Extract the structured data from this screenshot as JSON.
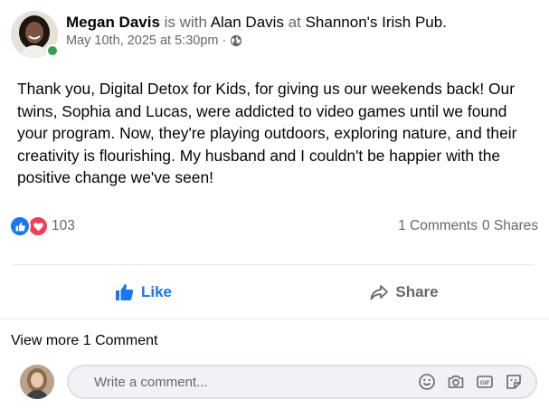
{
  "post": {
    "author": "Megan Davis",
    "with_text": " is with ",
    "tagged": "Alan Davis",
    "at_text": " at ",
    "place": "Shannon's Irish Pub.",
    "timestamp": "May 10th, 2025 at 5:30pm",
    "separator": "·",
    "privacy_icon": "globe-icon",
    "online": true,
    "body": "Thank you, Digital Detox for Kids, for giving us our weekends back! Our twins, Sophia and Lucas, were addicted to video games until we found your program. Now, they're playing outdoors, exploring nature, and their creativity is flourishing. My husband and I couldn't be happier with the positive change we've seen!"
  },
  "stats": {
    "reactions": [
      "like-icon",
      "love-icon"
    ],
    "reaction_count": "103",
    "comments": "1 Comments",
    "shares": "0 Shares"
  },
  "actions": {
    "like_label": "Like",
    "share_label": "Share"
  },
  "comments": {
    "view_more": "View more 1 Comment",
    "placeholder": "Write a comment...",
    "tools": [
      "emoji-icon",
      "camera-icon",
      "gif-icon",
      "sticker-icon"
    ]
  },
  "colors": {
    "brand_blue": "#1877f2",
    "love_red": "#f33e58",
    "online_green": "#31a24c",
    "secondary_text": "#65676b"
  }
}
